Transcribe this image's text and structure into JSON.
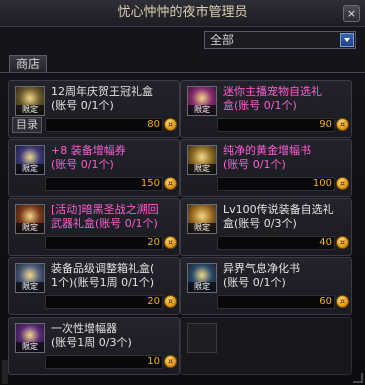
{
  "window": {
    "title": "忧心忡忡的夜市管理员",
    "close_label": "×"
  },
  "filter": {
    "selected": "全部"
  },
  "tab": {
    "label": "商店"
  },
  "items": [
    {
      "name_line1": "12周年庆贺王冠礼盒",
      "name_line2": "(账号 0/1个)",
      "name_color": "white",
      "limit_badge": "限定",
      "category": "目录",
      "price": "80",
      "icon": "crown-box-icon",
      "icon_color": "#6a5a2a"
    },
    {
      "name_line1": "迷你主播宠物自选礼",
      "name_line2": "盒(账号 0/1个)",
      "name_color": "pink",
      "limit_badge": "限定",
      "category": "",
      "price": "90",
      "icon": "pet-box-icon",
      "icon_color": "#8a2a70"
    },
    {
      "name_line1": "+8 装备增幅券",
      "name_line2": "(账号 0/1个)",
      "name_color": "pink",
      "limit_badge": "限定",
      "category": "",
      "price": "150",
      "icon": "amplify-ticket-icon",
      "icon_color": "#3a3a7a"
    },
    {
      "name_line1": "纯净的黄金增幅书",
      "name_line2": "(账号 0/1个)",
      "name_color": "pink",
      "limit_badge": "限定",
      "category": "",
      "price": "100",
      "icon": "gold-book-icon",
      "icon_color": "#8a6a20"
    },
    {
      "name_line1": "[活动]暗黑圣战之溯回",
      "name_line2": "武器礼盒(账号 0/1个)",
      "name_color": "pink",
      "limit_badge": "限定",
      "category": "",
      "price": "20",
      "icon": "weapon-box-icon",
      "icon_color": "#7a3a1a"
    },
    {
      "name_line1": "Lv100传说装备自选礼",
      "name_line2": "盒(账号 0/3个)",
      "name_color": "white",
      "limit_badge": "限定",
      "category": "",
      "price": "40",
      "icon": "legend-box-icon",
      "icon_color": "#9a6a20"
    },
    {
      "name_line1": "装备品级调整箱礼盒(",
      "name_line2": "1个)(账号1周 0/1个)",
      "name_color": "white",
      "limit_badge": "限定",
      "category": "",
      "price": "20",
      "icon": "grade-box-icon",
      "icon_color": "#4a5a7a"
    },
    {
      "name_line1": "异界气息净化书",
      "name_line2": "(账号 0/1个)",
      "name_color": "white",
      "limit_badge": "限定",
      "category": "",
      "price": "60",
      "icon": "purify-book-icon",
      "icon_color": "#2a4a6a"
    },
    {
      "name_line1": "一次性增幅器",
      "name_line2": "(账号1周 0/3个)",
      "name_color": "white",
      "limit_badge": "限定",
      "category": "",
      "price": "10",
      "icon": "amplifier-icon",
      "icon_color": "#5a2a7a"
    }
  ]
}
